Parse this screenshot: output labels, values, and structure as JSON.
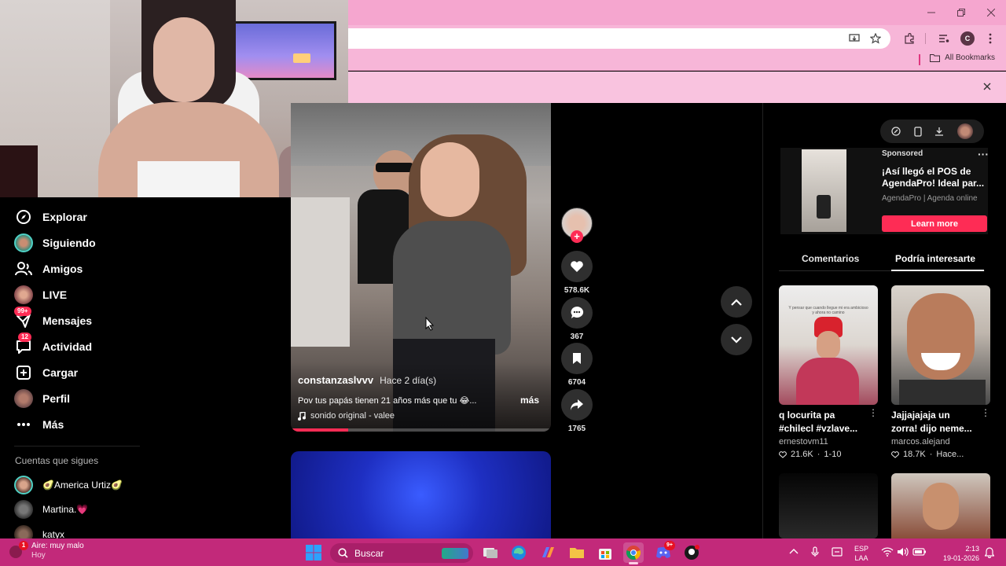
{
  "browser": {
    "bookmarks_all": "All Bookmarks",
    "profile_initial": "C"
  },
  "sidebar": {
    "items": [
      {
        "label": "Explorar",
        "icon": "compass-icon"
      },
      {
        "label": "Siguiendo",
        "icon": "following-avatar-icon"
      },
      {
        "label": "Amigos",
        "icon": "friends-icon"
      },
      {
        "label": "LIVE",
        "icon": "live-avatar-icon"
      },
      {
        "label": "Mensajes",
        "icon": "messages-icon",
        "badge": "99+"
      },
      {
        "label": "Actividad",
        "icon": "activity-icon",
        "badge": "12"
      },
      {
        "label": "Cargar",
        "icon": "upload-icon"
      },
      {
        "label": "Perfil",
        "icon": "profile-avatar-icon"
      },
      {
        "label": "Más",
        "icon": "more-icon"
      }
    ],
    "following_title": "Cuentas que sigues",
    "accounts": [
      {
        "name": "🥑America Urtiz🥑"
      },
      {
        "name": "Martina.💗"
      },
      {
        "name": "katyx"
      }
    ]
  },
  "video": {
    "username": "constanzaslvvv",
    "time": "Hace 2 día(s)",
    "caption": "Pov tus papás tienen 21 años más que tu 😂...",
    "more": "más",
    "music": "sonido original - valee",
    "progress": 0.22,
    "likes": "578.6K",
    "comments": "367",
    "saves": "6704",
    "shares": "1765"
  },
  "ad": {
    "sponsored": "Sponsored",
    "title": "¡Así llegó el POS de AgendaPro! Ideal par...",
    "source": "AgendaPro | Agenda online",
    "cta": "Learn more"
  },
  "tabs": {
    "comments": "Comentarios",
    "suggested": "Podría interesarte"
  },
  "cards": [
    {
      "title": "q locurita pa #chilecl #vzlave...",
      "author": "ernestovm11",
      "likes": "21.6K",
      "date": "1-10",
      "thumb_text": "Y pensar que cuando llegue mi era ambicioso y ahora no camino"
    },
    {
      "title": "Jajjajajaja un zorra! dijo neme...",
      "author": "marcos.alejand",
      "likes": "18.7K",
      "date": "Hace..."
    }
  ],
  "taskbar": {
    "weather": "Aire: muy malo",
    "weather_sub": "Hoy",
    "weather_badge": "1",
    "search_placeholder": "Buscar",
    "lang1": "ESP",
    "lang2": "LAA",
    "time": "2:13",
    "date": "19-01-2026",
    "discord_badge": "9+"
  },
  "colors": {
    "accent": "#fe2c55",
    "chrome_pink": "#f5a6cf",
    "taskbar": "#c2297a"
  }
}
